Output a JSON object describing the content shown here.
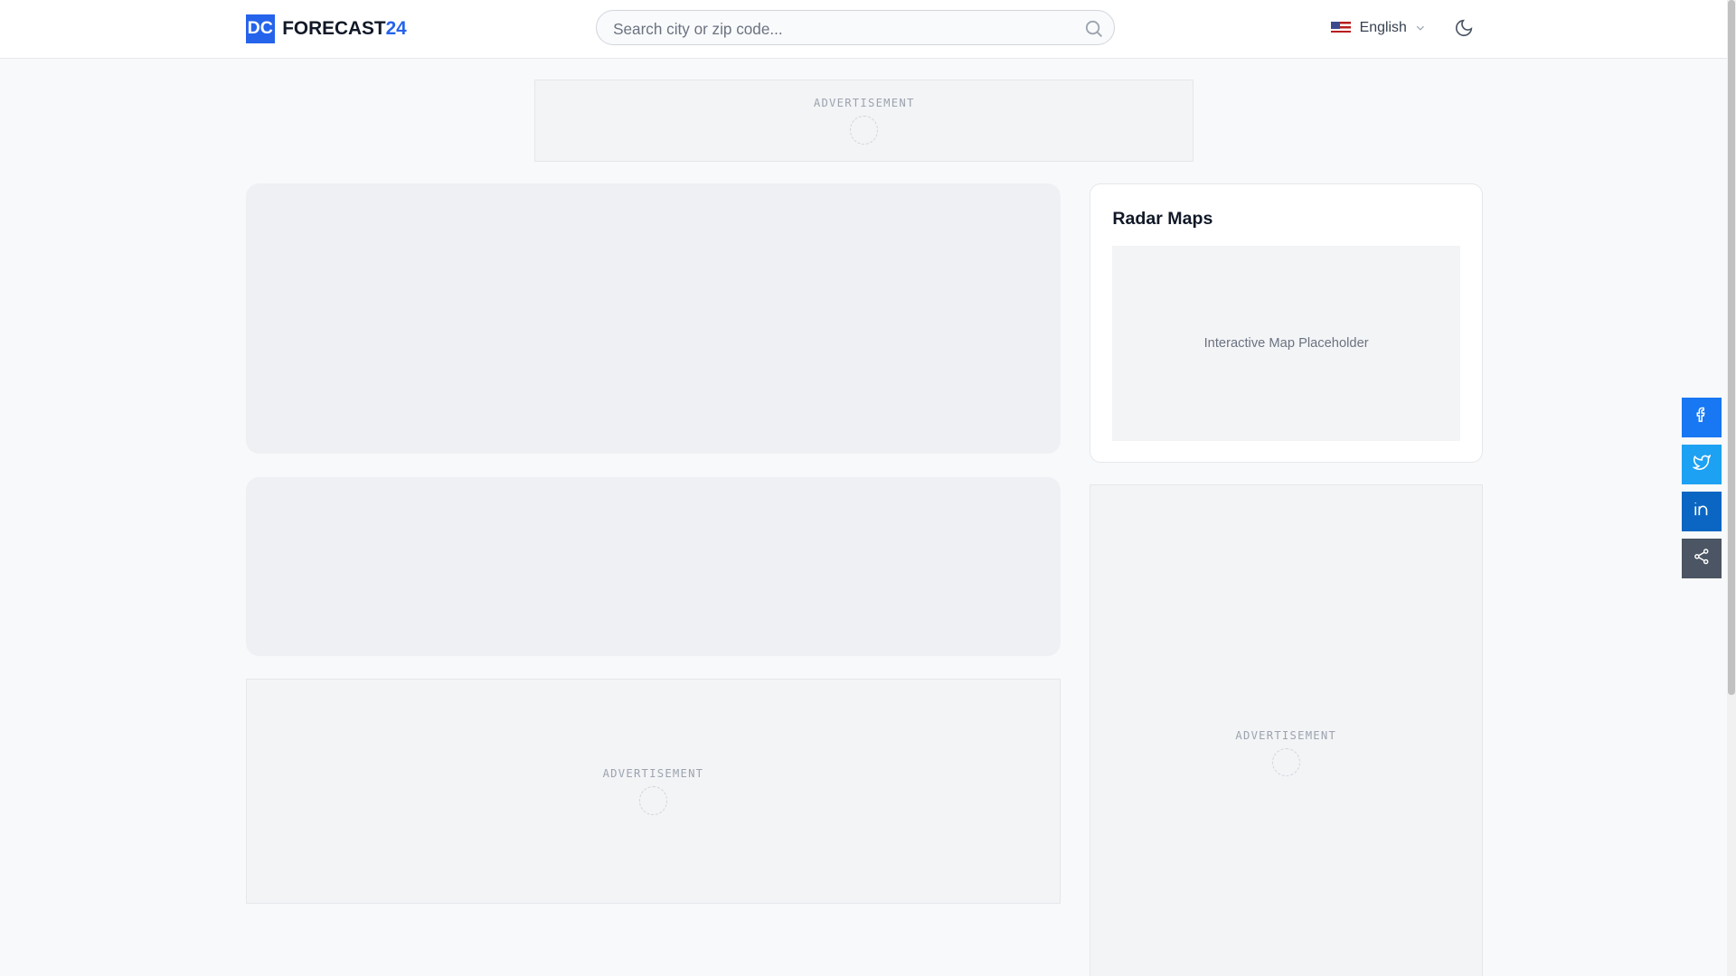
{
  "header": {
    "logo_badge": "DC",
    "logo_text": "FORECAST",
    "logo_number": "24",
    "search_placeholder": "Search city or zip code...",
    "language": "English"
  },
  "ads": {
    "label": "ADVERTISEMENT"
  },
  "radar": {
    "title": "Radar Maps",
    "map_placeholder": "Interactive Map Placeholder"
  },
  "share": [
    {
      "name": "facebook",
      "color": "#1877f2"
    },
    {
      "name": "twitter",
      "color": "#1da1f2"
    },
    {
      "name": "linkedin",
      "color": "#0a66c2"
    },
    {
      "name": "share",
      "color": "#4b5563"
    }
  ]
}
